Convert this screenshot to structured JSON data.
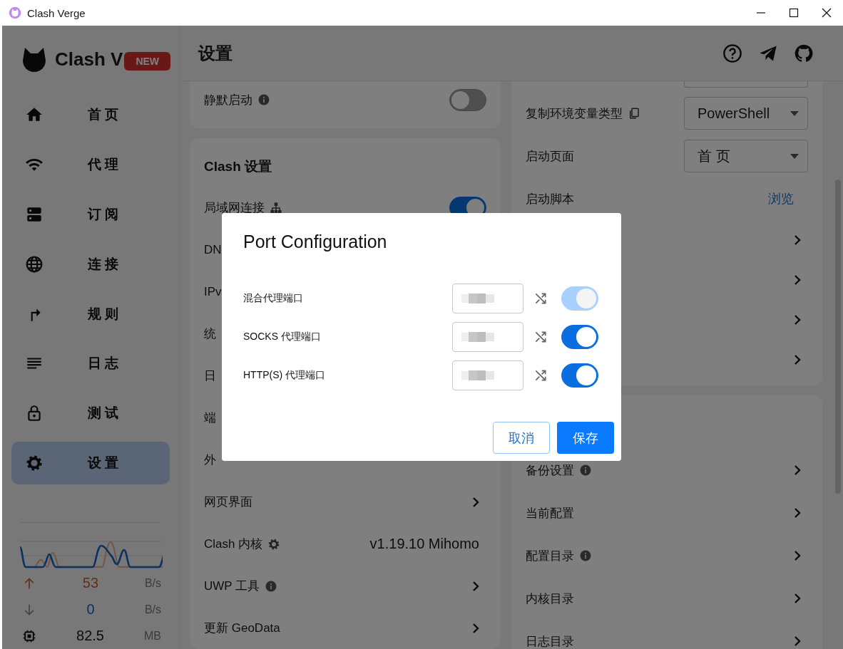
{
  "window": {
    "title": "Clash Verge"
  },
  "sidebar": {
    "logo_text": "Clash V",
    "badge": "NEW",
    "items": [
      {
        "kind": "home",
        "label": "首页",
        "selected": false
      },
      {
        "kind": "wifi",
        "label": "代理",
        "selected": false
      },
      {
        "kind": "servers",
        "label": "订阅",
        "selected": false
      },
      {
        "kind": "globe",
        "label": "连接",
        "selected": false
      },
      {
        "kind": "route",
        "label": "规则",
        "selected": false
      },
      {
        "kind": "lines",
        "label": "日志",
        "selected": false
      },
      {
        "kind": "lock",
        "label": "测试",
        "selected": false
      },
      {
        "kind": "gear",
        "label": "设置",
        "selected": true
      }
    ],
    "traffic": [
      {
        "kind": "up",
        "value": "53",
        "unit": "B/s"
      },
      {
        "kind": "down",
        "value": "0",
        "unit": "B/s"
      },
      {
        "kind": "memory",
        "value": "82.5",
        "unit": "MB"
      }
    ]
  },
  "header": {
    "title": "设置",
    "actions": [
      {
        "kind": "help"
      },
      {
        "kind": "send"
      },
      {
        "kind": "github"
      }
    ]
  },
  "columns": [
    {
      "cards": [
        {
          "rows": [
            {
              "label": "静默启动",
              "label_icon": {
                "kind": "info"
              },
              "kind": "toggle",
              "on": false
            }
          ]
        },
        {
          "title": "Clash 设置",
          "rows": [
            {
              "label": "局域网连接",
              "label_icon": {
                "kind": "network"
              },
              "kind": "toggle",
              "on": true
            },
            {
              "label": "DN",
              "kind": "plain"
            },
            {
              "label": "IPv",
              "kind": "plain"
            },
            {
              "label": "统",
              "kind": "plain"
            },
            {
              "label": "日",
              "kind": "plain"
            },
            {
              "label": "端",
              "kind": "plain"
            },
            {
              "label": "外",
              "kind": "plain"
            },
            {
              "label": "网页界面",
              "kind": "chevron"
            },
            {
              "label": "Clash 内核",
              "label_icon": {
                "kind": "gear"
              },
              "kind": "value",
              "value": "v1.19.10 Mihomo"
            },
            {
              "label": "UWP 工具",
              "label_icon": {
                "kind": "info"
              },
              "kind": "chevron"
            },
            {
              "label": "更新 GeoData",
              "kind": "chevron"
            }
          ]
        }
      ]
    },
    {
      "cards": [
        {
          "rows": [
            {
              "label": "复制环境变量类型",
              "label_icon": {
                "kind": "copy"
              },
              "kind": "select",
              "value": "PowerShell"
            },
            {
              "label": "启动页面",
              "kind": "select",
              "value": "首页"
            },
            {
              "label": "启动脚本",
              "kind": "link",
              "value": "浏览"
            },
            {
              "kind": "chevron"
            },
            {
              "kind": "chevron"
            },
            {
              "kind": "chevron"
            },
            {
              "kind": "chevron"
            }
          ]
        },
        {
          "rows": [
            {
              "label": "备份设置",
              "label_icon": {
                "kind": "info"
              },
              "kind": "chevron"
            },
            {
              "label": "当前配置",
              "kind": "chevron"
            },
            {
              "label": "配置目录",
              "label_icon": {
                "kind": "info"
              },
              "kind": "chevron"
            },
            {
              "label": "内核目录",
              "kind": "chevron"
            },
            {
              "label": "日志目录",
              "kind": "chevron"
            }
          ]
        }
      ]
    }
  ],
  "dialog": {
    "title": "Port Configuration",
    "ports": [
      {
        "label": "混合代理端口",
        "on": true,
        "disabled": true
      },
      {
        "label": "SOCKS 代理端口",
        "on": true,
        "disabled": false
      },
      {
        "label": "HTTP(S) 代理端口",
        "on": true,
        "disabled": false
      }
    ],
    "buttons": [
      {
        "label": "取消",
        "kind": "outlined"
      },
      {
        "label": "保存",
        "kind": "contained"
      }
    ]
  }
}
